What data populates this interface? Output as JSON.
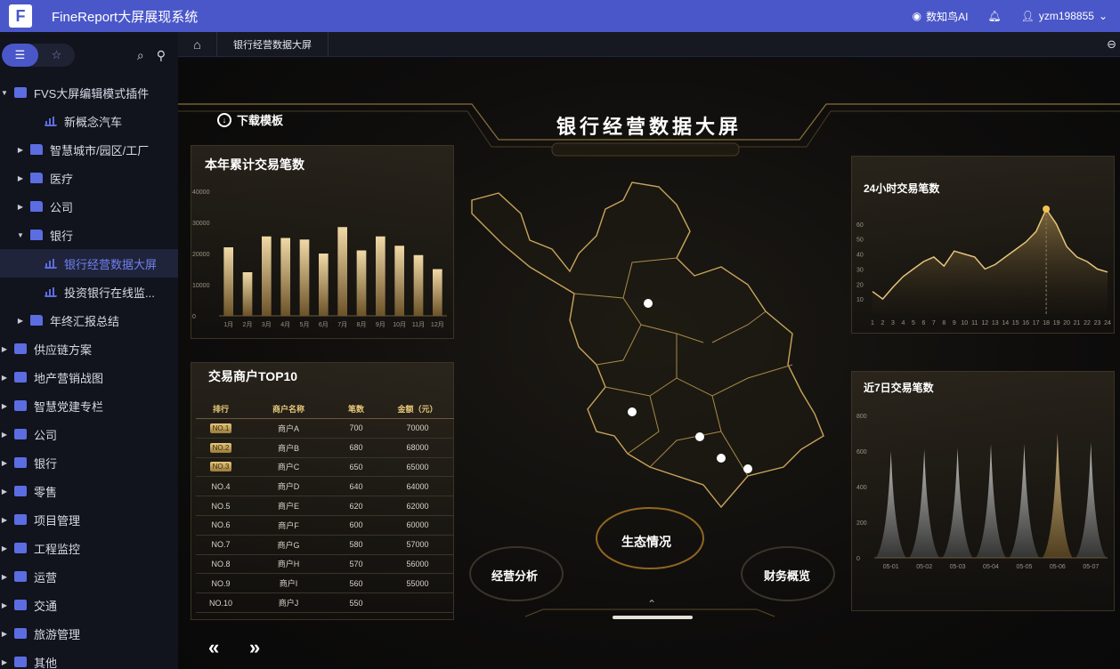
{
  "app": {
    "title": "FineReport大屏展现系统",
    "ai_label": "数知鸟AI",
    "username": "yzm198855"
  },
  "sidebar": {
    "items": [
      {
        "label": "FVS大屏编辑模式插件",
        "level": 0,
        "arrow": "▼"
      },
      {
        "label": "新概念汽车",
        "level": 2,
        "arrow": ""
      },
      {
        "label": "智慧城市/园区/工厂",
        "level": 1,
        "arrow": "▶"
      },
      {
        "label": "医疗",
        "level": 1,
        "arrow": "▶"
      },
      {
        "label": "公司",
        "level": 1,
        "arrow": "▶"
      },
      {
        "label": "银行",
        "level": 1,
        "arrow": "▼"
      },
      {
        "label": "银行经营数据大屏",
        "level": 2,
        "arrow": "",
        "selected": true
      },
      {
        "label": "投资银行在线监...",
        "level": 2,
        "arrow": ""
      },
      {
        "label": "年终汇报总结",
        "level": 1,
        "arrow": "▶"
      },
      {
        "label": "供应链方案",
        "level": 0,
        "arrow": "▶"
      },
      {
        "label": "地产营销战图",
        "level": 0,
        "arrow": "▶"
      },
      {
        "label": "智慧党建专栏",
        "level": 0,
        "arrow": "▶"
      },
      {
        "label": "公司",
        "level": 0,
        "arrow": "▶"
      },
      {
        "label": "银行",
        "level": 0,
        "arrow": "▶"
      },
      {
        "label": "零售",
        "level": 0,
        "arrow": "▶"
      },
      {
        "label": "项目管理",
        "level": 0,
        "arrow": "▶"
      },
      {
        "label": "工程监控",
        "level": 0,
        "arrow": "▶"
      },
      {
        "label": "运营",
        "level": 0,
        "arrow": "▶"
      },
      {
        "label": "交通",
        "level": 0,
        "arrow": "▶"
      },
      {
        "label": "旅游管理",
        "level": 0,
        "arrow": "▶"
      },
      {
        "label": "其他",
        "level": 0,
        "arrow": "▶"
      }
    ]
  },
  "tabs": {
    "active": "银行经营数据大屏"
  },
  "dashboard": {
    "title": "银行经营数据大屏",
    "download": "下载模板",
    "left_top_title": "本年累计交易笔数",
    "left_bottom_title": "交易商户TOP10",
    "right_top_title": "24小时交易笔数",
    "right_bottom_title": "近7日交易笔数",
    "center_label": "生态情况",
    "left_label": "经营分析",
    "right_label": "财务概览",
    "table": {
      "headers": [
        "排行",
        "商户名称",
        "笔数",
        "金额（元）"
      ],
      "rows": [
        [
          "NO.1",
          "商户A",
          "700",
          "70000"
        ],
        [
          "NO.2",
          "商户B",
          "680",
          "68000"
        ],
        [
          "NO.3",
          "商户C",
          "650",
          "65000"
        ],
        [
          "NO.4",
          "商户D",
          "640",
          "64000"
        ],
        [
          "NO.5",
          "商户E",
          "620",
          "62000"
        ],
        [
          "NO.6",
          "商户F",
          "600",
          "60000"
        ],
        [
          "NO.7",
          "商户G",
          "580",
          "57000"
        ],
        [
          "NO.8",
          "商户H",
          "570",
          "56000"
        ],
        [
          "NO.9",
          "商户I",
          "560",
          "55000"
        ],
        [
          "NO.10",
          "商户J",
          "550",
          ""
        ]
      ]
    }
  },
  "chart_data": [
    {
      "type": "bar",
      "title": "本年累计交易笔数",
      "categories": [
        "1月",
        "2月",
        "3月",
        "4月",
        "5月",
        "6月",
        "7月",
        "8月",
        "9月",
        "10月",
        "11月",
        "12月"
      ],
      "values": [
        22000,
        14000,
        25500,
        25000,
        24500,
        20000,
        28500,
        21000,
        25500,
        22500,
        19500,
        15000
      ],
      "yticks": [
        "40000",
        "30000",
        "20000",
        "10000",
        "0"
      ],
      "ylim": [
        0,
        40000
      ]
    },
    {
      "type": "area",
      "title": "24小时交易笔数",
      "x": [
        "1",
        "2",
        "3",
        "4",
        "5",
        "6",
        "7",
        "8",
        "9",
        "10",
        "11",
        "12",
        "13",
        "14",
        "15",
        "16",
        "17",
        "18",
        "19",
        "20",
        "21",
        "22",
        "23",
        "24"
      ],
      "values": [
        15,
        10,
        18,
        25,
        30,
        35,
        38,
        32,
        42,
        40,
        38,
        30,
        33,
        38,
        43,
        48,
        55,
        70,
        60,
        45,
        38,
        35,
        30,
        28
      ],
      "yticks": [
        "60",
        "50",
        "40",
        "30",
        "20",
        "10"
      ],
      "ylim": [
        0,
        70
      ]
    },
    {
      "type": "area",
      "title": "近7日交易笔数",
      "categories": [
        "05-01",
        "05-02",
        "05-03",
        "05-04",
        "05-05",
        "05-06",
        "05-07"
      ],
      "values": [
        600,
        610,
        620,
        640,
        640,
        700,
        650
      ],
      "highlight_index": 5,
      "yticks": [
        "800",
        "600",
        "400",
        "200",
        "0"
      ],
      "ylim": [
        0,
        800
      ]
    }
  ]
}
